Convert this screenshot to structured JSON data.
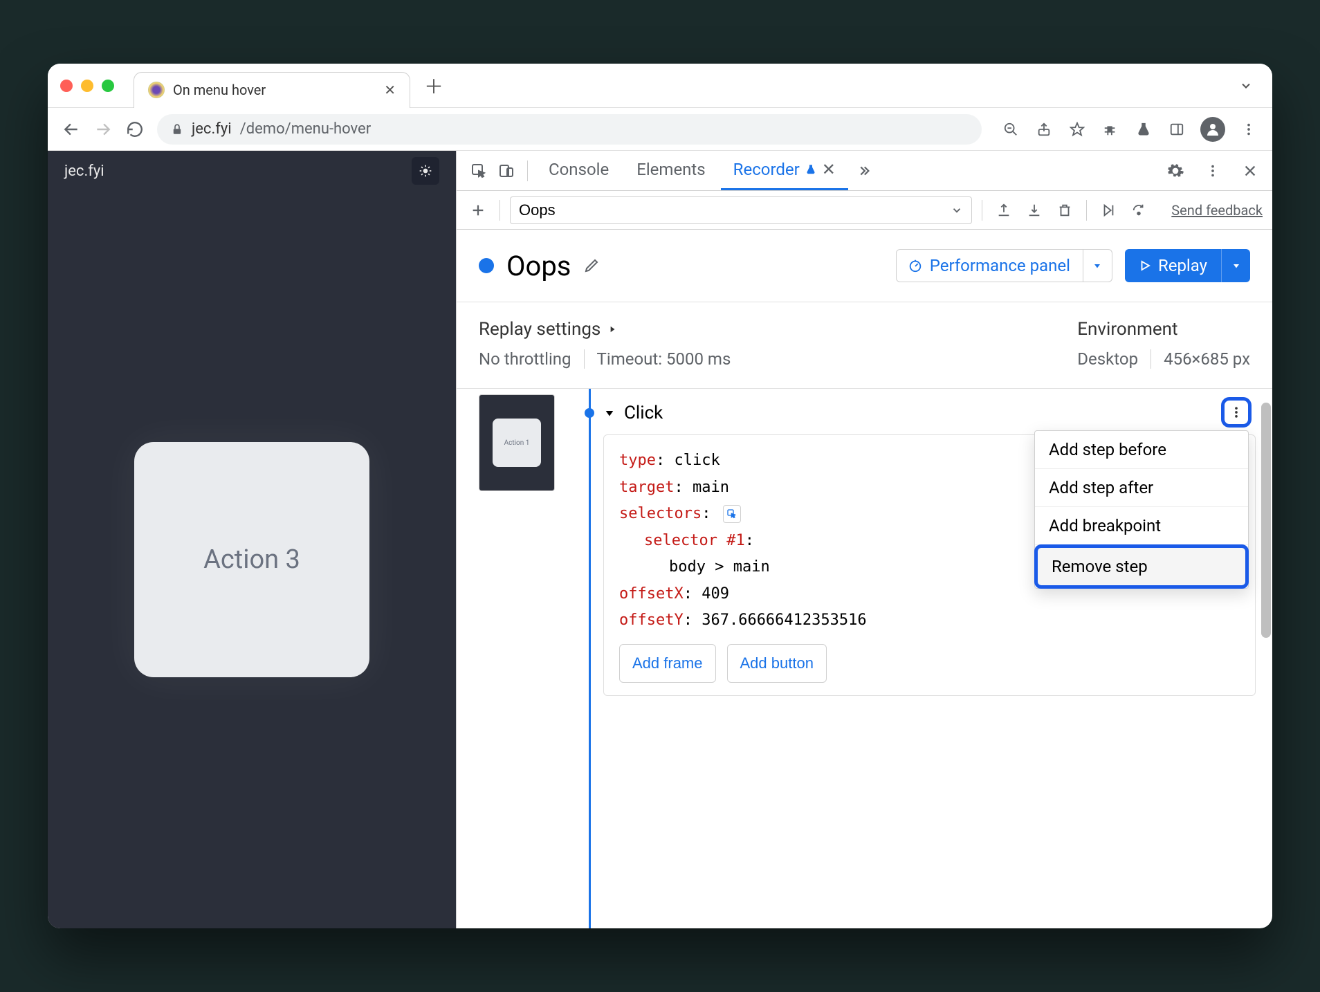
{
  "browser": {
    "tab_title": "On menu hover",
    "url_host": "jec.fyi",
    "url_path": "/demo/menu-hover"
  },
  "page": {
    "site_name": "jec.fyi",
    "card_label": "Action 3"
  },
  "devtools": {
    "tabs": {
      "console": "Console",
      "elements": "Elements",
      "recorder": "Recorder"
    },
    "toolbar": {
      "recording_name": "Oops",
      "feedback": "Send feedback"
    },
    "header": {
      "recording_title": "Oops",
      "perf_button": "Performance panel",
      "replay_button": "Replay"
    },
    "settings": {
      "replay_title": "Replay settings",
      "throttling": "No throttling",
      "timeout": "Timeout: 5000 ms",
      "env_title": "Environment",
      "env_device": "Desktop",
      "env_size": "456×685 px"
    },
    "step": {
      "thumb_label": "Action 1",
      "title": "Click",
      "props": {
        "type_k": "type",
        "type_v": "click",
        "target_k": "target",
        "target_v": "main",
        "selectors_k": "selectors",
        "sel1_k": "selector #1",
        "sel1_v": "body > main",
        "offx_k": "offsetX",
        "offx_v": "409",
        "offy_k": "offsetY",
        "offy_v": "367.66666412353516"
      },
      "add_frame": "Add frame",
      "add_button": "Add button"
    },
    "menu": {
      "before": "Add step before",
      "after": "Add step after",
      "breakpoint": "Add breakpoint",
      "remove": "Remove step"
    }
  }
}
